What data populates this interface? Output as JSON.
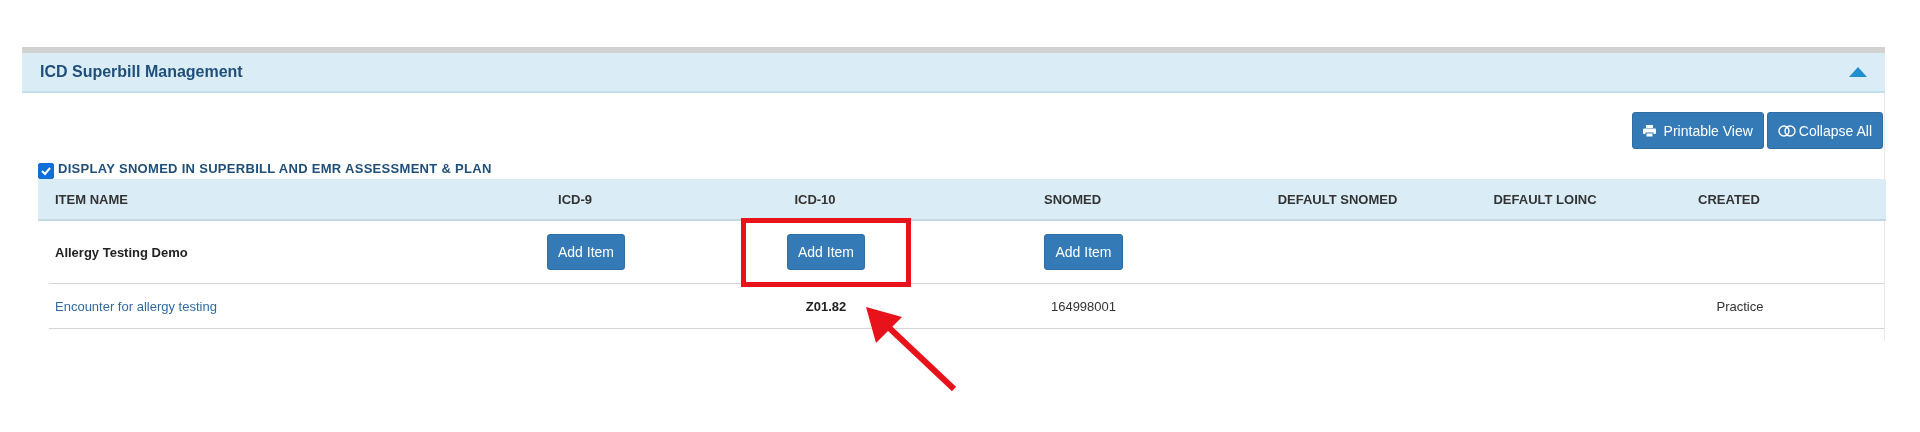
{
  "panel": {
    "title": "ICD Superbill Management",
    "expanded": true
  },
  "toolbar": {
    "buttons": [
      {
        "kind": "print",
        "label": "Printable View"
      },
      {
        "kind": "collapse",
        "label": "Collapse All"
      }
    ]
  },
  "option": {
    "label": "DISPLAY SNOMED IN SUPERBILL AND EMR ASSESSMENT & PLAN",
    "checked": true
  },
  "table": {
    "columns": [
      "ITEM NAME",
      "ICD-9",
      "ICD-10",
      "SNOMED",
      "DEFAULT SNOMED",
      "DEFAULT LOINC",
      "CREATED"
    ],
    "rows": [
      {
        "cells": [
          {
            "kind": "bold",
            "text": "Allergy Testing Demo"
          },
          {
            "kind": "button",
            "text": "Add Item",
            "highlighted": false
          },
          {
            "kind": "button",
            "text": "Add Item",
            "highlighted": true
          },
          {
            "kind": "button",
            "text": "Add Item",
            "highlighted": false
          },
          {
            "kind": "empty"
          },
          {
            "kind": "empty"
          },
          {
            "kind": "empty"
          }
        ]
      },
      {
        "cells": [
          {
            "kind": "link",
            "text": "Encounter for allergy testing"
          },
          {
            "kind": "empty"
          },
          {
            "kind": "bold",
            "text": "Z01.82"
          },
          {
            "kind": "text",
            "text": "164998001"
          },
          {
            "kind": "empty"
          },
          {
            "kind": "empty"
          },
          {
            "kind": "text",
            "text": "Practice"
          }
        ]
      }
    ]
  }
}
